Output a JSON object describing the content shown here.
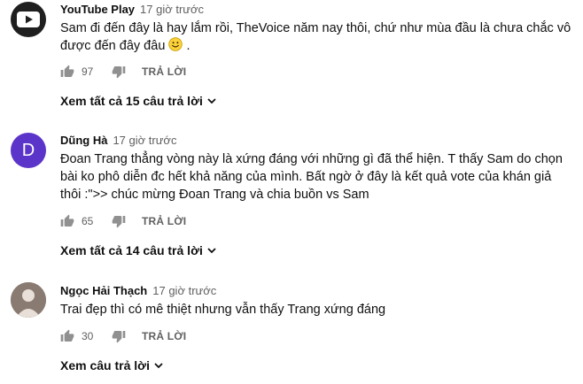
{
  "comments": [
    {
      "author": "YouTube Play",
      "time": "17 giờ trước",
      "avatar_icon": "youtube-logo-icon",
      "text": "Sam đi đến đây là hay lắm rồi, TheVoice năm nay thôi, chứ như mùa đầu là chưa chắc vô được đến đây đâu",
      "text_suffix": ".",
      "likes": "97",
      "reply_label": "TRẢ LỜI",
      "view_replies": "Xem tất cả 15 câu trả lời"
    },
    {
      "author": "Dũng Hà",
      "time": "17 giờ trước",
      "avatar_letter": "D",
      "avatar_color": "#5b35c9",
      "text": "Đoan Trang thẳng vòng này là xứng đáng với những gì đã thể hiện. T thấy Sam do chọn bài ko phô diễn đc hết khả năng của mình. Bất ngờ ở đây là kết quả vote của khán giả thôi :\">> chúc mừng Đoan Trang và chia buồn vs Sam",
      "likes": "65",
      "reply_label": "TRẢ LỜI",
      "view_replies": "Xem tất cả 14 câu trả lời"
    },
    {
      "author": "Ngọc Hải Thạch",
      "time": "17 giờ trước",
      "avatar_icon": "default-user-avatar-icon",
      "text": "Trai đẹp thì có mê thiệt nhưng vẫn thấy Trang xứng đáng",
      "likes": "30",
      "reply_label": "TRẢ LỜI",
      "view_replies": "Xem câu trả lời"
    }
  ],
  "colors": {
    "text_primary": "#0f0f0f",
    "text_secondary": "#606060",
    "youtube_red": "#ff0000"
  }
}
